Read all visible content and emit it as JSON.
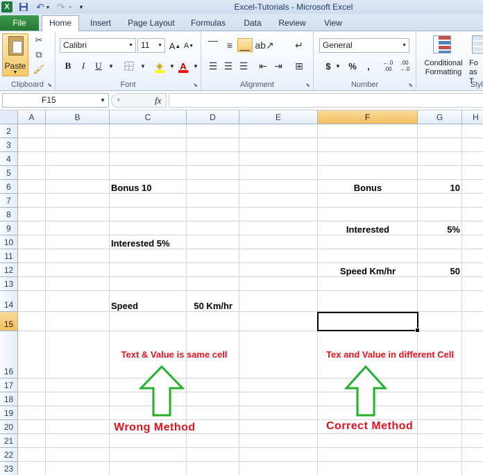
{
  "window": {
    "title": "Excel-Tutorials  -  Microsoft Excel",
    "logo_letter": "X"
  },
  "tabs": [
    "File",
    "Home",
    "Insert",
    "Page Layout",
    "Formulas",
    "Data",
    "Review",
    "View"
  ],
  "ribbon": {
    "clipboard": {
      "label": "Clipboard",
      "paste": "Paste"
    },
    "font": {
      "label": "Font",
      "name": "Calibri",
      "size": "11",
      "bold": "B",
      "italic": "I",
      "underline": "U",
      "font_color_glyph": "A"
    },
    "alignment": {
      "label": "Alignment"
    },
    "number": {
      "label": "Number",
      "format": "General",
      "currency": "$",
      "percent": "%",
      "comma": ",",
      "inc_decimal": "←.0 .00",
      "dec_decimal": ".00 →.0"
    },
    "styles": {
      "label": "Style",
      "conditional_formatting": "Conditional Formatting",
      "format_as_table": "Fo as T"
    }
  },
  "formula_bar": {
    "name_box": "F15",
    "fx": "fx",
    "value": ""
  },
  "sheet": {
    "columns": [
      "A",
      "B",
      "C",
      "D",
      "E",
      "F",
      "G",
      "H"
    ],
    "selected_column": "F",
    "rows": [
      "2",
      "3",
      "4",
      "5",
      "6",
      "7",
      "8",
      "9",
      "10",
      "11",
      "12",
      "13",
      "14",
      "15",
      "16",
      "17",
      "18",
      "19",
      "20",
      "21",
      "22",
      "23"
    ],
    "selected_row": "15",
    "cells": {
      "C6": "Bonus 10",
      "C10": "Interested 5%",
      "C14": "Speed",
      "D14": "50 Km/hr",
      "F6": "Bonus",
      "G6": "10",
      "F9": "Interested",
      "G9": "5%",
      "F12": "Speed Km/hr",
      "G12": "50"
    },
    "active_cell": "F15"
  },
  "annotations": {
    "left_note": "Text & Value is same cell",
    "right_note": "Tex and Value in different Cell",
    "left_method": "Wrong Method",
    "right_method": "Correct Method",
    "arrow_color": "#20b02a",
    "text_color": "#e0141e"
  }
}
